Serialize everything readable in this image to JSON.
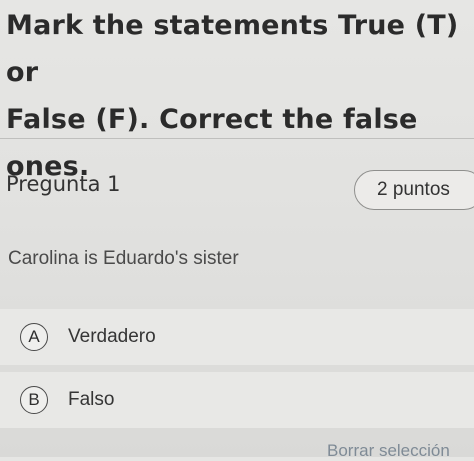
{
  "instructions": {
    "line1": "Mark the statements True (T) or",
    "line2": "False (F). Correct the false ones."
  },
  "question": {
    "title": "Pregunta 1",
    "points": "2 puntos",
    "text": "Carolina is Eduardo's sister"
  },
  "options": [
    {
      "letter": "A",
      "label": "Verdadero"
    },
    {
      "letter": "B",
      "label": "Falso"
    }
  ],
  "clear_selection": "Borrar selección"
}
